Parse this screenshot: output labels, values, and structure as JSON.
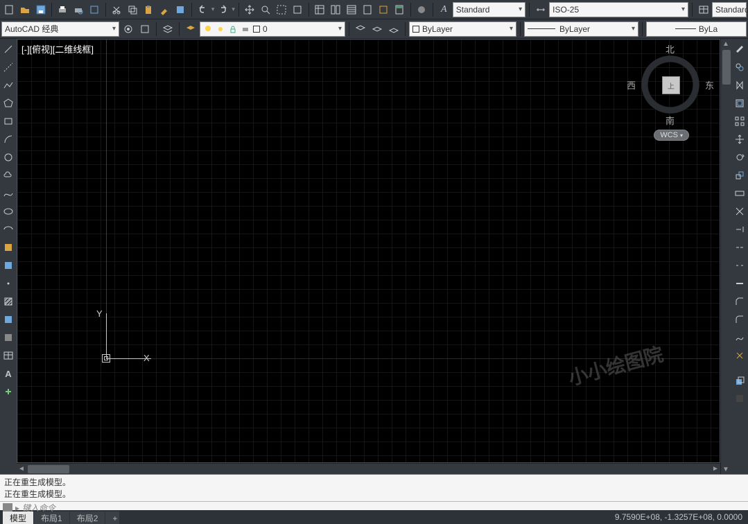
{
  "toolbar1": {
    "textStyle": "Standard",
    "dimStyle": "ISO-25",
    "tableStyle": "Standard"
  },
  "toolbar2": {
    "workspace": "AutoCAD 经典",
    "layerValue": "0",
    "layerProp": "ByLayer",
    "linetype": "ByLayer",
    "lineweight": "ByLa"
  },
  "canvas": {
    "viewLabel": "[-][俯视][二维线框]",
    "yLabel": "Y",
    "xLabel": "X",
    "watermark": "小小绘图院",
    "viewcube": {
      "n": "北",
      "s": "南",
      "e": "东",
      "w": "西",
      "top": "上"
    },
    "wcs": "WCS"
  },
  "command": {
    "hist1": "正在重生成模型。",
    "hist2": "正在重生成模型。",
    "placeholder": "键入命令"
  },
  "tabs": {
    "model": "模型",
    "layout1": "布局1",
    "layout2": "布局2"
  },
  "status": {
    "coords": "9.7590E+08, -1.3257E+08, 0.0000"
  }
}
